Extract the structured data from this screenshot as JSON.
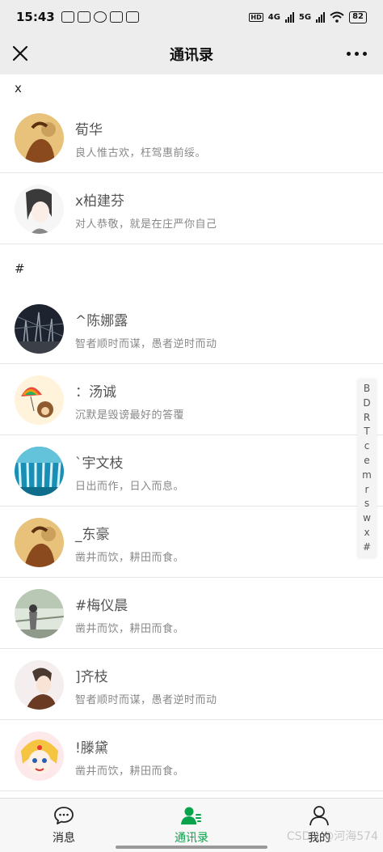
{
  "status_bar": {
    "time": "15:43",
    "network_1": "4G",
    "network_2": "5G",
    "battery": "82"
  },
  "header": {
    "title": "通讯录"
  },
  "sections": [
    {
      "letter": "x",
      "contacts": [
        {
          "name": "荀华",
          "signature": "良人惟古欢，枉驾惠前绥。"
        },
        {
          "name": "x柏建芬",
          "signature": "对人恭敬，就是在庄严你自己"
        }
      ]
    },
    {
      "letter": "#",
      "contacts": [
        {
          "name": "^陈娜露",
          "signature": "智者顺时而谋，愚者逆时而动"
        },
        {
          "name": "：汤诚",
          "signature": "沉默是毁谤最好的答覆"
        },
        {
          "name": "`宇文枝",
          "signature": "日出而作，日入而息。"
        },
        {
          "name": "_东豪",
          "signature": "凿井而饮，耕田而食。"
        },
        {
          "name": "#梅仪晨",
          "signature": "凿井而饮，耕田而食。"
        },
        {
          "name": "]齐枝",
          "signature": "智者顺时而谋，愚者逆时而动"
        },
        {
          "name": "!滕黛",
          "signature": "凿井而饮，耕田而食。"
        }
      ]
    }
  ],
  "index_letters": [
    "B",
    "D",
    "R",
    "T",
    "c",
    "e",
    "m",
    "r",
    "s",
    "w",
    "x",
    "#"
  ],
  "tabs": [
    {
      "label": "消息",
      "icon": "message-icon"
    },
    {
      "label": "通讯录",
      "icon": "contacts-icon"
    },
    {
      "label": "我的",
      "icon": "profile-icon"
    }
  ],
  "watermark": "CSDN @河海574",
  "colors": {
    "accent": "#07a34a",
    "header_bg": "#ededed"
  }
}
